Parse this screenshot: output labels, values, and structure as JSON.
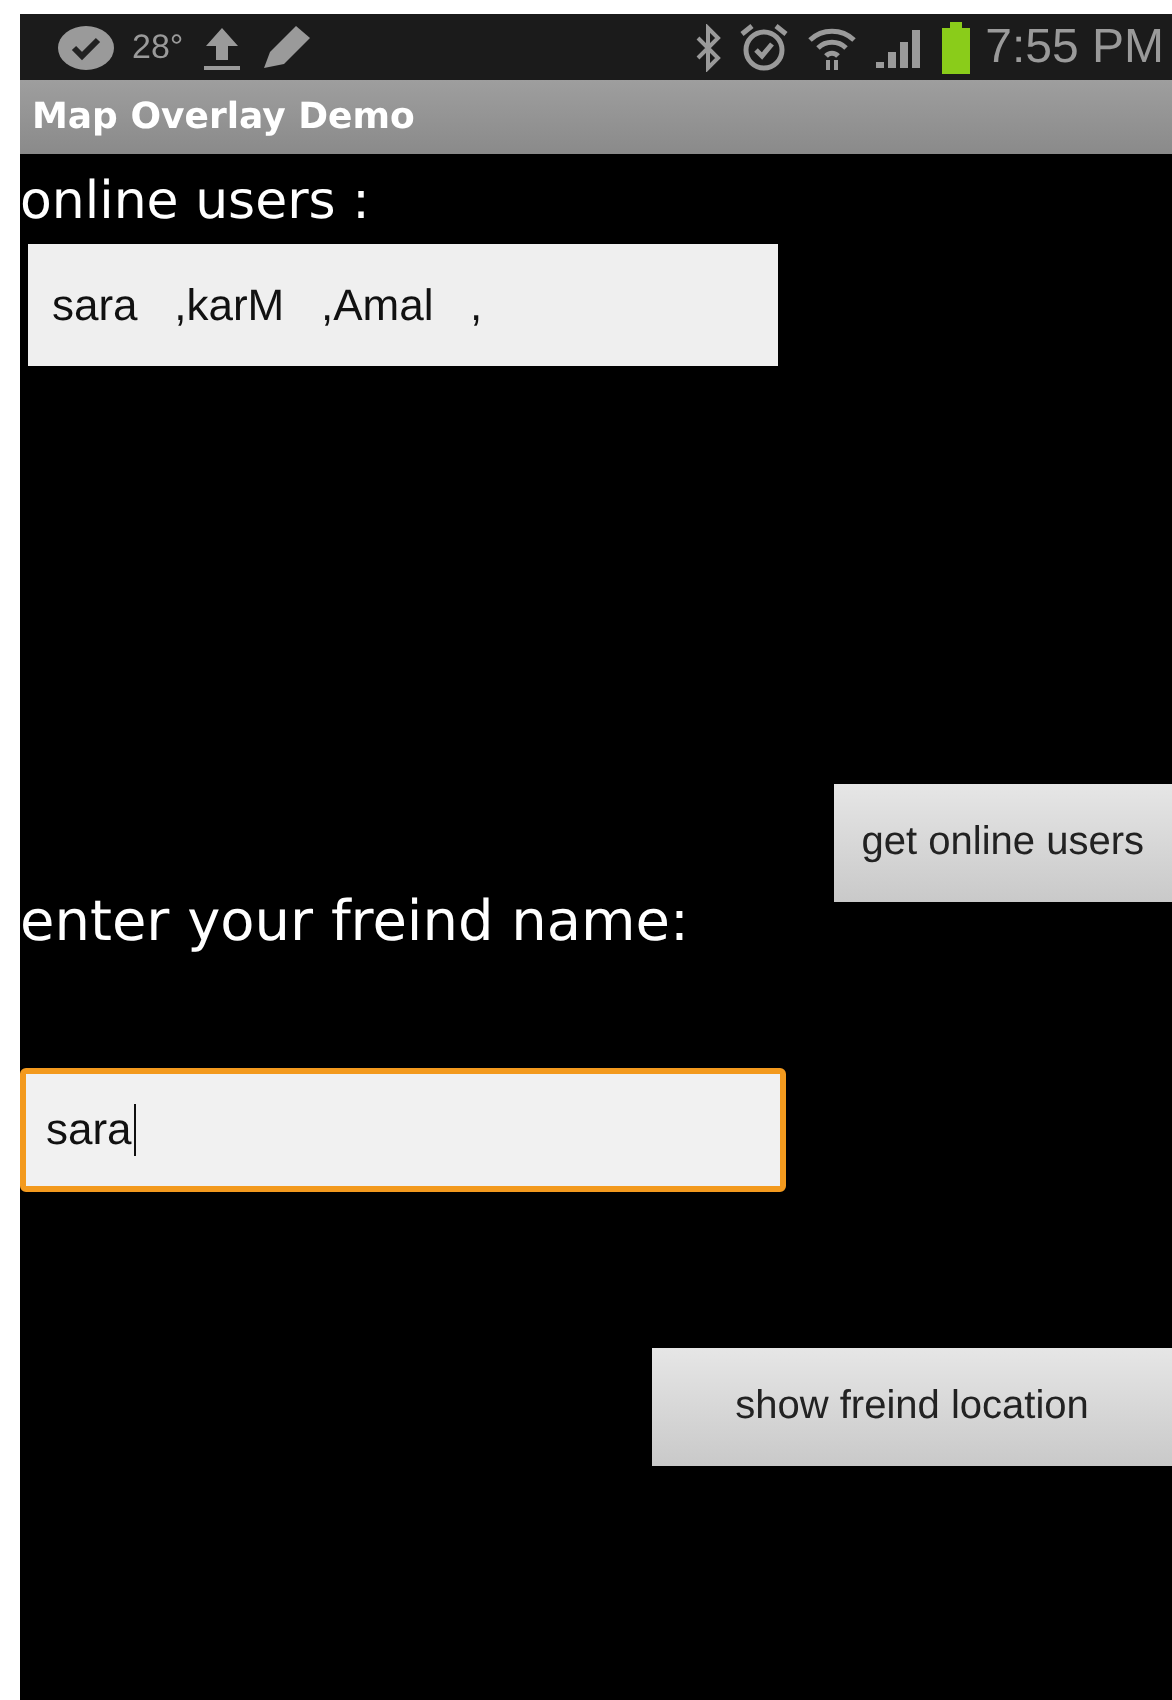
{
  "status_bar": {
    "temperature": "28°",
    "time": "7:55 PM"
  },
  "title_bar": {
    "title": "Map Overlay Demo"
  },
  "online_users": {
    "label": "online users :",
    "value": "sara   ,karM   ,Amal   ,"
  },
  "get_button": {
    "label": "get online users"
  },
  "friend": {
    "label": "enter your freind name:",
    "value": "sara",
    "focused": true
  },
  "show_button": {
    "label": "show freind location"
  }
}
